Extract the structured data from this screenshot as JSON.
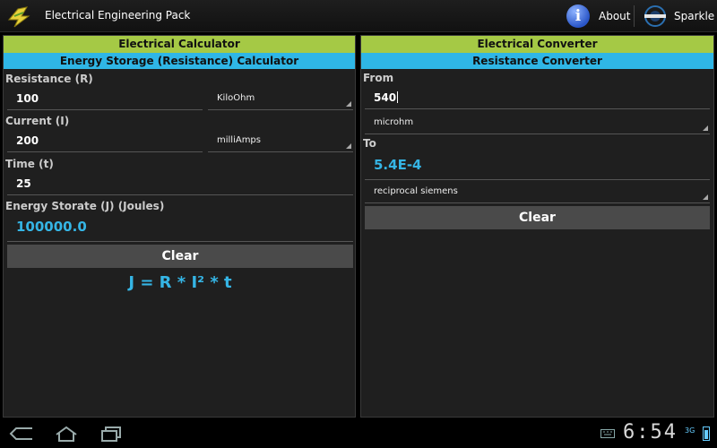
{
  "app": {
    "title": "Electrical Engineering Pack"
  },
  "actionbar": {
    "about_label": "About",
    "sparkle_label": "Sparkle"
  },
  "calculator": {
    "header": "Electrical Calculator",
    "subheader": "Energy Storage (Resistance) Calculator",
    "resistance": {
      "label": "Resistance (R)",
      "value": "100",
      "unit": "KiloOhm"
    },
    "current": {
      "label": "Current (I)",
      "value": "200",
      "unit": "milliAmps"
    },
    "time": {
      "label": "Time (t)",
      "value": "25"
    },
    "energy": {
      "label": "Energy Storate (J) (Joules)",
      "value": "100000.0"
    },
    "clear_label": "Clear",
    "formula": "J = R * I² * t"
  },
  "converter": {
    "header": "Electrical Converter",
    "subheader": "Resistance Converter",
    "from_label": "From",
    "from_value": "540",
    "from_unit": "microhm",
    "to_label": "To",
    "to_value": "5.4E-4",
    "to_unit": "reciprocal siemens",
    "clear_label": "Clear"
  },
  "statusbar": {
    "time": "6:54",
    "network": "3G"
  },
  "colors": {
    "green": "#a5c945",
    "blue": "#2fb6e6",
    "accent_text": "#35b5e5"
  },
  "icons": [
    "app-bulb-icon",
    "info-icon",
    "sparkle-logo-icon",
    "back-icon",
    "home-icon",
    "recent-apps-icon",
    "keyboard-icon",
    "battery-icon"
  ]
}
